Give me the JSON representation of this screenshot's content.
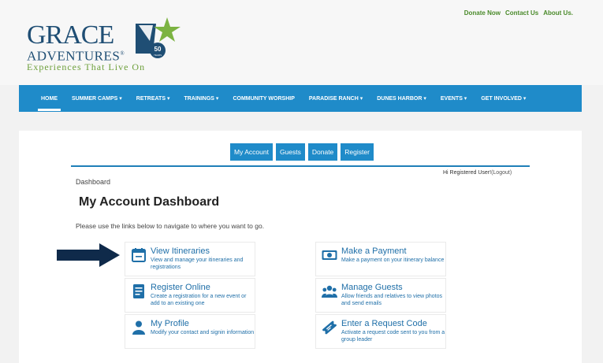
{
  "top_links": [
    "Donate Now",
    "Contact Us",
    "About Us."
  ],
  "logo": {
    "line1": "GRACE",
    "line2": "ADVENTURES",
    "tagline": "Experiences That Live On",
    "badge_number": "50",
    "badge_text": "YEARS",
    "colors": {
      "navy": "#1f4e74",
      "green": "#6ea03c"
    }
  },
  "nav": [
    "HOME",
    "SUMMER CAMPS ▾",
    "RETREATS ▾",
    "TRAININGS ▾",
    "COMMUNITY WORSHIP",
    "PARADISE RANCH ▾",
    "DUNES HARBOR ▾",
    "EVENTS ▾",
    "GET INVOLVED ▾"
  ],
  "tabs": [
    "My Account",
    "Guests",
    "Donate",
    "Register"
  ],
  "greeting": "Hi Registered User!",
  "logout": "(Logout)",
  "breadcrumb": "Dashboard",
  "page_title": "My Account Dashboard",
  "intro": "Please use the links below to navigate to where you want to go.",
  "tiles": [
    {
      "title": "View Itineraries",
      "desc": "View and manage your itineraries and registrations",
      "icon": "calendar-icon"
    },
    {
      "title": "Make a Payment",
      "desc": "Make a payment on your itinerary balance",
      "icon": "money-icon"
    },
    {
      "title": "Register Online",
      "desc": "Create a registration for a new event or add to an existing one",
      "icon": "form-icon"
    },
    {
      "title": "Manage Guests",
      "desc": "Allow friends and relatives to view photos and send emails",
      "icon": "users-icon"
    },
    {
      "title": "My Profile",
      "desc": "Modify your contact and signin information",
      "icon": "user-icon"
    },
    {
      "title": "Enter a Request Code",
      "desc": "Activate a request code sent to you from a group leader",
      "icon": "ticket-icon"
    }
  ],
  "colors": {
    "accent": "#1f8bc9",
    "link": "#1f6fa8",
    "arrow": "#0f2a4a",
    "top_link": "#4a8a2a"
  }
}
